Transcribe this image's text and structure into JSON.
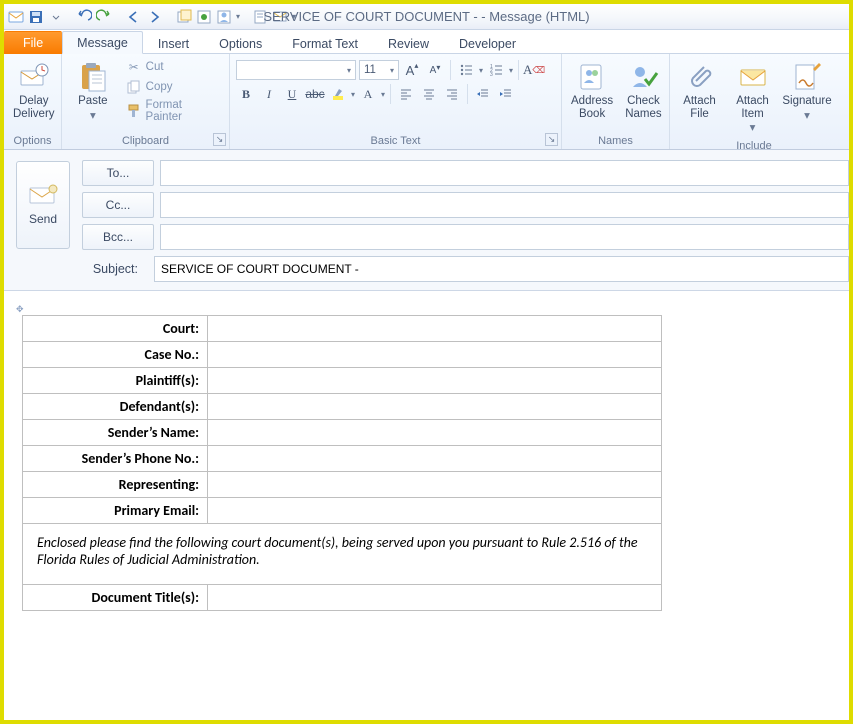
{
  "window": {
    "title": "SERVICE OF COURT DOCUMENT -  - Message (HTML)"
  },
  "tabs": {
    "file": "File",
    "message": "Message",
    "insert": "Insert",
    "options": "Options",
    "format_text": "Format Text",
    "review": "Review",
    "developer": "Developer"
  },
  "ribbon": {
    "options_group": "Options",
    "delay_delivery": "Delay Delivery",
    "clipboard_group": "Clipboard",
    "paste": "Paste",
    "cut": "Cut",
    "copy": "Copy",
    "format_painter": "Format Painter",
    "basic_text_group": "Basic Text",
    "font_name": "",
    "font_size": "11",
    "names_group": "Names",
    "address_book": "Address Book",
    "check_names": "Check Names",
    "include_group": "Include",
    "attach_file": "Attach File",
    "attach_item": "Attach Item",
    "signature": "Signature"
  },
  "compose": {
    "send": "Send",
    "to": "To...",
    "cc": "Cc...",
    "bcc": "Bcc...",
    "subject_label": "Subject:",
    "subject_value": "SERVICE OF COURT DOCUMENT - "
  },
  "doc": {
    "rows": {
      "court": "Court:",
      "case_no": "Case No.:",
      "plaintiffs": "Plaintiff(s):",
      "defendants": "Defendant(s):",
      "sender_name": "Sender’s Name:",
      "sender_phone": "Sender’s Phone No.:",
      "representing": "Representing:",
      "primary_email": "Primary Email:",
      "doc_titles": "Document Title(s):"
    },
    "body_text": "Enclosed please find  the following court document(s), being served upon you pursuant to Rule 2.516 of the Florida Rules of Judicial Administration."
  }
}
